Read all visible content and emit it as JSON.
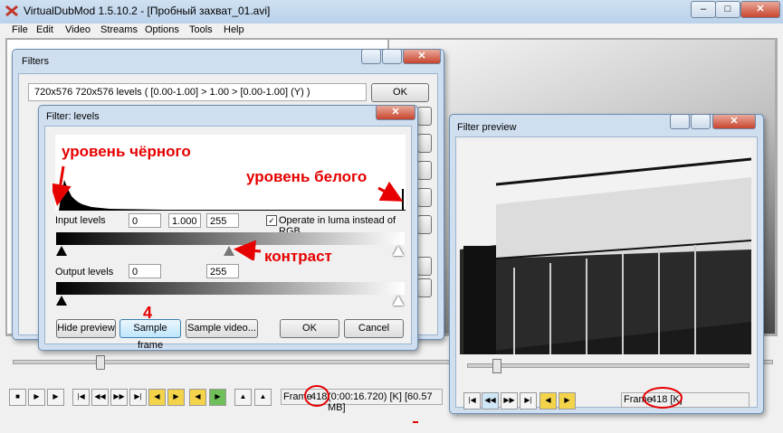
{
  "app": {
    "title": "VirtualDubMod 1.5.10.2 - [Пробный захват_01.avi]"
  },
  "menu": [
    "File",
    "Edit",
    "Video",
    "Streams",
    "Options",
    "Tools",
    "Help"
  ],
  "filters_dialog": {
    "title": "Filters",
    "entry": "720x576  720x576  levels ( [0.00-1.00] > 1.00 > [0.00-1.00] (Y) )",
    "ok": "OK"
  },
  "levels_dialog": {
    "title": "Filter: levels",
    "input_label": "Input levels",
    "input_values": [
      "0",
      "1.000",
      "255"
    ],
    "luma_checkbox": "Operate in luma instead of RGB",
    "output_label": "Output levels",
    "output_values": [
      "0",
      "255"
    ],
    "buttons": {
      "hide_preview": "Hide preview",
      "sample_frame": "Sample frame",
      "sample_video": "Sample video...",
      "ok": "OK",
      "cancel": "Cancel"
    }
  },
  "preview_dialog": {
    "title": "Filter preview",
    "frame_label": "Frame",
    "frame_value": "418 [K]"
  },
  "statusbar": {
    "frame_label": "Frame",
    "frame_number": "418",
    "rest": "(0:00:16.720) [K] [60.57 MB]"
  },
  "annotations": {
    "black_level": "уровень чёрного",
    "white_level": "уровень белого",
    "contrast": "контраст",
    "step_number": "4",
    "accent": "#e60000"
  }
}
